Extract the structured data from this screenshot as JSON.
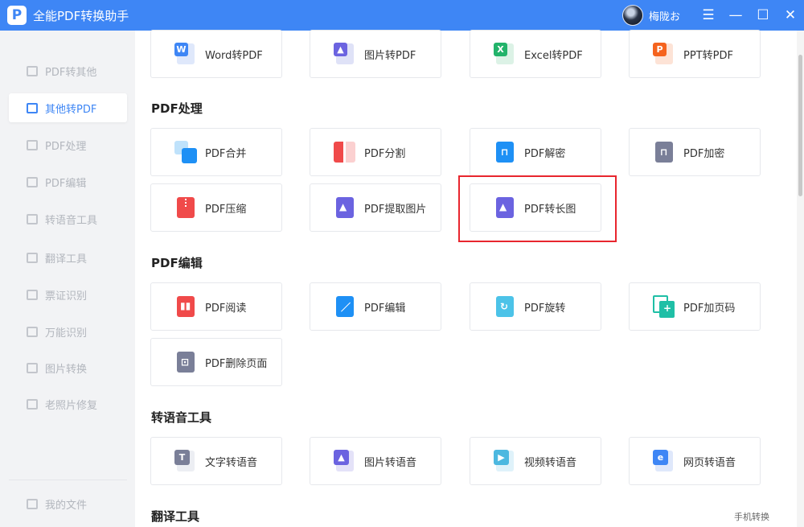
{
  "app": {
    "title": "全能PDF转换助手",
    "logo_letter": "P"
  },
  "user": {
    "name": "梅陇お"
  },
  "window_controls": {
    "menu": "☰",
    "minimize": "—",
    "maximize": "☐",
    "close": "✕"
  },
  "sidebar": {
    "items": [
      {
        "label": "PDF转其他",
        "active": false
      },
      {
        "label": "其他转PDF",
        "active": true
      },
      {
        "label": "PDF处理",
        "active": false
      },
      {
        "label": "PDF编辑",
        "active": false
      },
      {
        "label": "转语音工具",
        "active": false
      },
      {
        "label": "翻译工具",
        "active": false
      },
      {
        "label": "票证识别",
        "active": false
      },
      {
        "label": "万能识别",
        "active": false
      },
      {
        "label": "图片转换",
        "active": false
      },
      {
        "label": "老照片修复",
        "active": false
      }
    ],
    "footer": {
      "label": "我的文件"
    }
  },
  "sections": {
    "convert": {
      "tools": [
        {
          "label": "Word转PDF",
          "icon": "word-icon"
        },
        {
          "label": "图片转PDF",
          "icon": "image-icon"
        },
        {
          "label": "Excel转PDF",
          "icon": "excel-icon"
        },
        {
          "label": "PPT转PDF",
          "icon": "ppt-icon"
        }
      ]
    },
    "process": {
      "title": "PDF处理",
      "tools": [
        {
          "label": "PDF合并",
          "icon": "merge-icon"
        },
        {
          "label": "PDF分割",
          "icon": "split-icon"
        },
        {
          "label": "PDF解密",
          "icon": "unlock-icon"
        },
        {
          "label": "PDF加密",
          "icon": "lock-icon"
        },
        {
          "label": "PDF压缩",
          "icon": "compress-icon"
        },
        {
          "label": "PDF提取图片",
          "icon": "extract-image-icon"
        },
        {
          "label": "PDF转长图",
          "icon": "long-image-icon"
        }
      ]
    },
    "edit": {
      "title": "PDF编辑",
      "tools": [
        {
          "label": "PDF阅读",
          "icon": "read-icon"
        },
        {
          "label": "PDF编辑",
          "icon": "edit-icon"
        },
        {
          "label": "PDF旋转",
          "icon": "rotate-icon"
        },
        {
          "label": "PDF加页码",
          "icon": "page-number-icon"
        },
        {
          "label": "PDF删除页面",
          "icon": "delete-page-icon"
        }
      ]
    },
    "speech": {
      "title": "转语音工具",
      "tools": [
        {
          "label": "文字转语音",
          "icon": "text-speech-icon"
        },
        {
          "label": "图片转语音",
          "icon": "image-speech-icon"
        },
        {
          "label": "视频转语音",
          "icon": "video-speech-icon"
        },
        {
          "label": "网页转语音",
          "icon": "web-speech-icon"
        }
      ]
    },
    "translate": {
      "title": "翻译工具"
    }
  },
  "mobile_link": "手机转换",
  "colors": {
    "accent": "#3e86f5",
    "highlight": "#e8262e",
    "red": "#f04a4a",
    "purple": "#6b63e0",
    "green": "#22b36a",
    "orange": "#f5631e",
    "slate": "#7a7f98"
  }
}
